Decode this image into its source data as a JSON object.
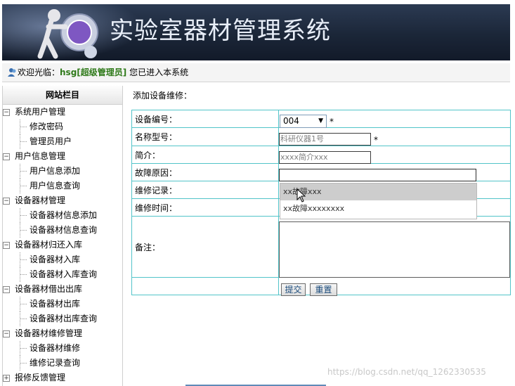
{
  "header": {
    "title": "实验室器材管理系统"
  },
  "welcome": {
    "prefix": "欢迎光临：",
    "user": "hsg[超级管理员]",
    "suffix": " 您已进入本系统"
  },
  "sidebar": {
    "title": "网站栏目",
    "groups": [
      {
        "label": "系统用户管理",
        "items": [
          "修改密码",
          "管理员用户"
        ]
      },
      {
        "label": "用户信息管理",
        "items": [
          "用户信息添加",
          "用户信息查询"
        ]
      },
      {
        "label": "设备器材管理",
        "items": [
          "设备器材信息添加",
          "设备器材信息查询"
        ]
      },
      {
        "label": "设备器材归还入库",
        "items": [
          "设备器材入库",
          "设备器材入库查询"
        ]
      },
      {
        "label": "设备器材借出出库",
        "items": [
          "设备器材出库",
          "设备器材出库查询"
        ]
      },
      {
        "label": "设备器材维修管理",
        "items": [
          "设备器材维修",
          "维修记录查询"
        ]
      },
      {
        "label": "报修反馈管理",
        "items": []
      }
    ]
  },
  "form": {
    "heading": "添加设备维修：",
    "rows": {
      "device_no_label": "设备编号：",
      "device_no_value": "004",
      "model_label": "名称型号：",
      "model_value": "科研仪器1号",
      "intro_label": "简介：",
      "intro_value": "xxxx简介xxx",
      "fault_label": "故障原因：",
      "fault_value": "",
      "record_label": "维修记录：",
      "time_label": "维修时间：",
      "remark_label": "备注："
    },
    "required_mark": "*",
    "autocomplete": [
      "xx故障xxx",
      "xx故障xxxxxxxx"
    ],
    "submit_label": "提交",
    "reset_label": "重置"
  },
  "watermark": "https://blog.csdn.net/qq_1262330535"
}
